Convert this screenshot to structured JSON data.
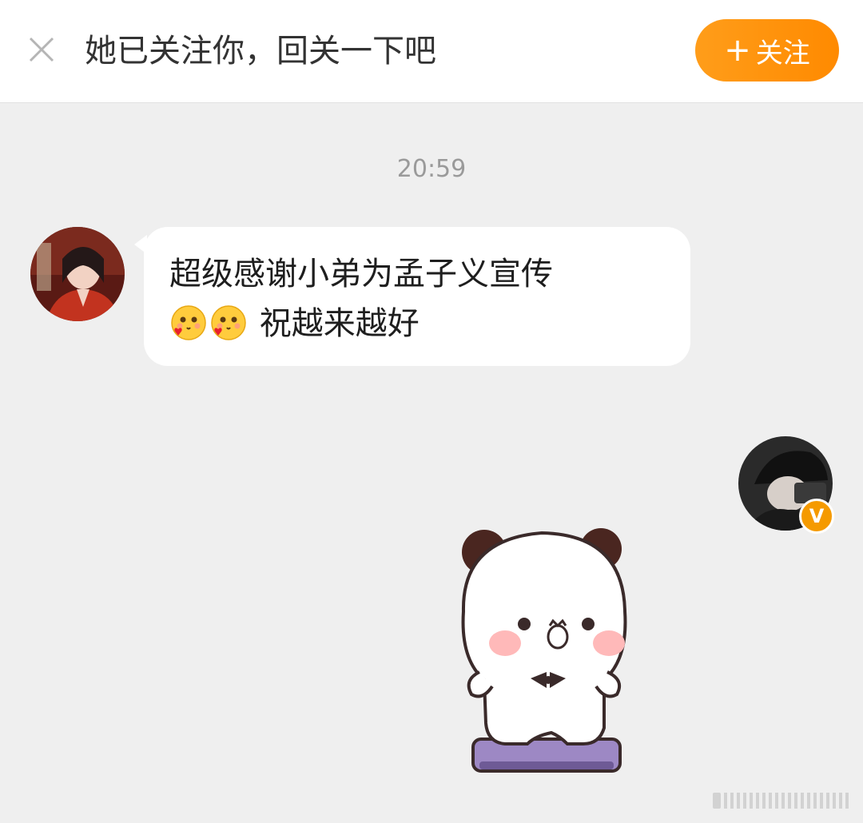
{
  "header": {
    "follow_prompt": "她已关注你，回关一下吧",
    "follow_button": {
      "plus": "+",
      "label": "关注"
    },
    "close_icon": "close-icon"
  },
  "chat": {
    "timestamp": "20:59",
    "messages": [
      {
        "sender": "left",
        "line1": "超级感谢小弟为孟子义宣传",
        "line2": "祝越来越好",
        "emojis": [
          "smiling-heart-emoji",
          "smiling-heart-emoji"
        ]
      },
      {
        "sender": "right",
        "type": "sticker",
        "sticker": "panda-on-scale-sticker"
      }
    ],
    "right_avatar_badge": "V"
  },
  "colors": {
    "accent": "#ff8f0a",
    "background": "#efefef",
    "bubble": "#ffffff",
    "badge": "#f59a00"
  }
}
